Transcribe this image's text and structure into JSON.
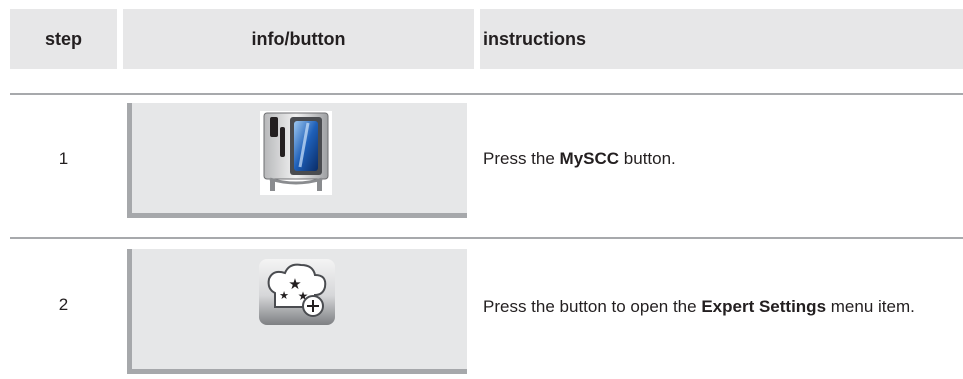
{
  "header": {
    "step": "step",
    "info": "info/button",
    "instructions": "instructions"
  },
  "rows": [
    {
      "step": "1",
      "icon": "mysc-oven-icon",
      "instr_pre": "Press the ",
      "instr_bold": "MySCC",
      "instr_post": " button."
    },
    {
      "step": "2",
      "icon": "expert-settings-icon",
      "instr_pre": "Press the button to open the ",
      "instr_bold": "Expert Settings",
      "instr_post": " menu item."
    }
  ]
}
